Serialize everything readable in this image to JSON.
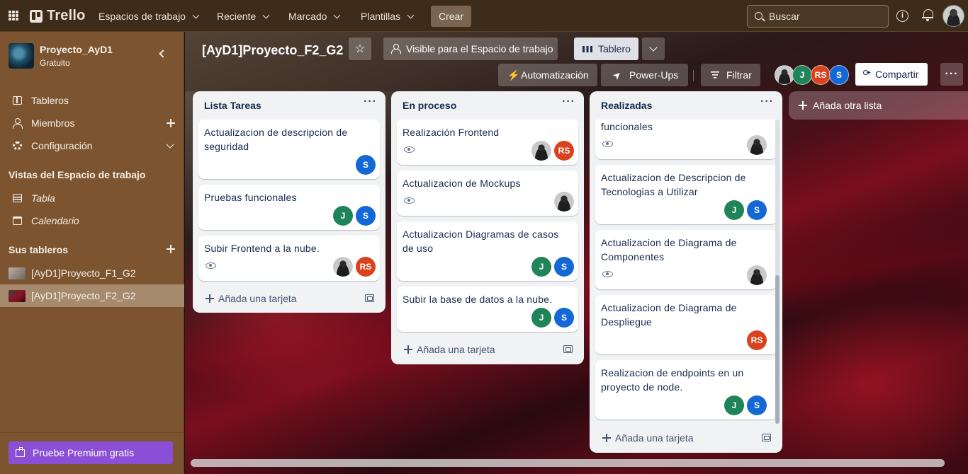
{
  "topbar": {
    "app_name": "Trello",
    "nav": [
      "Espacios de trabajo",
      "Reciente",
      "Marcado",
      "Plantillas"
    ],
    "create": "Crear",
    "search_placeholder": "Buscar"
  },
  "sidebar": {
    "workspace_name": "Proyecto_AyD1",
    "workspace_plan": "Gratuito",
    "items": [
      {
        "label": "Tableros",
        "icon": "board-icon"
      },
      {
        "label": "Miembros",
        "icon": "user-icon"
      },
      {
        "label": "Configuración",
        "icon": "gear-icon"
      }
    ],
    "views_heading": "Vistas del Espacio de trabajo",
    "views": [
      {
        "label": "Tabla",
        "icon": "table-icon"
      },
      {
        "label": "Calendario",
        "icon": "calendar-icon"
      }
    ],
    "boards_heading": "Sus tableros",
    "boards": [
      {
        "label": "[AyD1]Proyecto_F1_G2",
        "active": false
      },
      {
        "label": "[AyD1]Proyecto_F2_G2",
        "active": true
      }
    ],
    "premium": "Pruebe Premium gratis"
  },
  "board": {
    "title": "[AyD1]Proyecto_F2_G2",
    "visibility": "Visible para el Espacio de trabajo",
    "view": "Tablero",
    "automation": "Automatización",
    "powerups": "Power-Ups",
    "filter": "Filtrar",
    "members": [
      "J",
      "RS",
      "S"
    ],
    "share": "Compartir",
    "add_list": "Añada otra lista",
    "add_card": "Añada una tarjeta"
  },
  "lists": [
    {
      "title": "Lista Tareas",
      "cards": [
        {
          "text": "Actualizacion de descripcion de seguridad",
          "members": [
            "S"
          ]
        },
        {
          "text": "Pruebas funcionales",
          "members": [
            "J",
            "S"
          ]
        },
        {
          "text": "Subir Frontend a la nube.",
          "watch": true,
          "members": [
            "photo",
            "RS"
          ]
        }
      ]
    },
    {
      "title": "En proceso",
      "cards": [
        {
          "text": "Realización Frontend",
          "watch": true,
          "members": [
            "photo",
            "RS"
          ]
        },
        {
          "text": "Actualizacion de Mockups",
          "watch": true,
          "members": [
            "photo"
          ]
        },
        {
          "text": "Actualizacion Diagramas de casos de uso",
          "members": [
            "J",
            "S"
          ]
        },
        {
          "text": "Subir la base de datos a la nube.",
          "members": [
            "J",
            "S"
          ]
        }
      ]
    },
    {
      "title": "Realizadas",
      "cards": [
        {
          "text": "funcionales",
          "watch": true,
          "members": [
            "photo"
          ]
        },
        {
          "text": "Actualizacion de Descripcion de Tecnologias a Utilizar",
          "members": [
            "J",
            "S"
          ]
        },
        {
          "text": "Actualizacion de Diagrama de Componentes",
          "watch": true,
          "members": [
            "photo"
          ]
        },
        {
          "text": "Actualizacion de Diagrama de Despliegue",
          "members": [
            "RS"
          ]
        },
        {
          "text": "Realizacion de endpoints en un proyecto de node.",
          "members": [
            "J",
            "S"
          ]
        }
      ]
    }
  ],
  "colors": {
    "member_s": "#1468d6",
    "member_j": "#1f845a",
    "member_rs": "#d9421d",
    "premium": "#8a4fd6",
    "sidebar": "#7c5530"
  }
}
